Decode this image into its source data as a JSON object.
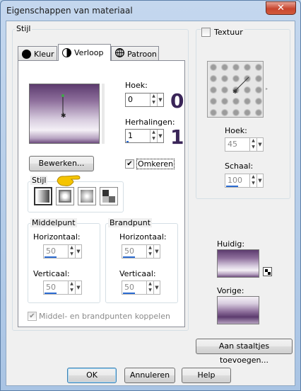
{
  "window": {
    "title": "Eigenschappen van materiaal",
    "close_label": "✕"
  },
  "style_group": {
    "label": "Stijl",
    "tabs": [
      {
        "label": "Kleur",
        "icon": "black-circle-icon"
      },
      {
        "label": "Verloop",
        "icon": "half-circle-icon"
      },
      {
        "label": "Patroon",
        "icon": "globe-grid-icon"
      }
    ],
    "angle": {
      "label": "Hoek:",
      "value": "0",
      "annotation": "0"
    },
    "repeats": {
      "label": "Herhalingen:",
      "value": "1",
      "annotation": "1"
    },
    "edit_button": "Bewerken...",
    "invert": {
      "label": "Omkeren",
      "checked": true,
      "check": "✔"
    },
    "style_subgroup": {
      "label": "Stijl"
    },
    "center_point": {
      "label": "Middelpunt",
      "horizontal": {
        "label": "Horizontaal:",
        "value": "50"
      },
      "vertical": {
        "label": "Verticaal:",
        "value": "50"
      }
    },
    "focal_point": {
      "label": "Brandpunt",
      "horizontal": {
        "label": "Horizontaal:",
        "value": "50"
      },
      "vertical": {
        "label": "Verticaal:",
        "value": "50"
      }
    },
    "link_points": {
      "label": "Middel- en brandpunten koppelen",
      "checked": true,
      "check": "✔"
    }
  },
  "texture": {
    "label": "Textuur",
    "checked": false,
    "angle": {
      "label": "Hoek:",
      "value": "45"
    },
    "scale": {
      "label": "Schaal:",
      "value": "100"
    }
  },
  "current": {
    "label": "Huidig:"
  },
  "previous": {
    "label": "Vorige:"
  },
  "add_swatches_button": "Aan staaltjes toevoegen...",
  "footer": {
    "ok": "OK",
    "cancel": "Annuleren",
    "help": "Help"
  },
  "colors": {
    "gradient_dark": "#5c3b6e",
    "gradient_light": "#f4f0f6",
    "accent_number": "#3a2558",
    "pointer_hand": "#f5c400"
  }
}
